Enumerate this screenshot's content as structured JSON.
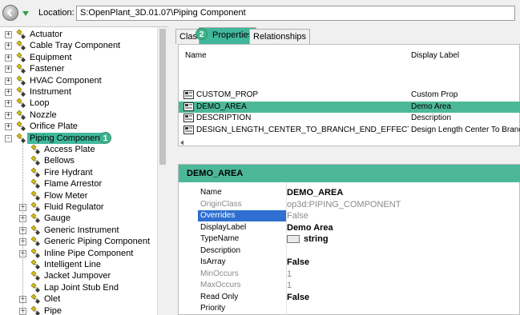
{
  "location": {
    "label": "Location:",
    "path": "S:OpenPlant_3D.01.07\\Piping Component"
  },
  "tree": {
    "top_items": [
      "Actuator",
      "Cable Tray Component",
      "Equipment",
      "Fastener",
      "HVAC Component",
      "Instrument",
      "Loop",
      "Nozzle",
      "Orifice Plate"
    ],
    "selected": "Piping Component",
    "selected_badge": "1",
    "children": [
      {
        "label": "Access Plate",
        "expandable": false
      },
      {
        "label": "Bellows",
        "expandable": false
      },
      {
        "label": "Fire Hydrant",
        "expandable": false
      },
      {
        "label": "Flame Arrestor",
        "expandable": false
      },
      {
        "label": "Flow Meter",
        "expandable": false
      },
      {
        "label": "Fluid Regulator",
        "expandable": true
      },
      {
        "label": "Gauge",
        "expandable": true
      },
      {
        "label": "Generic Instrument",
        "expandable": true
      },
      {
        "label": "Generic Piping Component",
        "expandable": true
      },
      {
        "label": "Inline Pipe Component",
        "expandable": true
      },
      {
        "label": "Intelligent Line",
        "expandable": false
      },
      {
        "label": "Jacket Jumpover",
        "expandable": false
      },
      {
        "label": "Lap Joint Stub End",
        "expandable": false
      },
      {
        "label": "Olet",
        "expandable": true
      },
      {
        "label": "Pipe",
        "expandable": true
      }
    ]
  },
  "tabs": {
    "class": "Class",
    "properties": "Properties",
    "relationships": "Relationships",
    "badge": "2"
  },
  "grid": {
    "col_name": "Name",
    "col_label": "Display Label",
    "rows": [
      {
        "name": "CUSTOM_PROP",
        "label": "Custom Prop"
      },
      {
        "name": "DEMO_AREA",
        "label": "Demo Area"
      },
      {
        "name": "DESCRIPTION",
        "label": "Description"
      },
      {
        "name": "DESIGN_LENGTH_CENTER_TO_BRANCH_END_EFFECTIVE",
        "label": "Design Length Center To Branch"
      }
    ]
  },
  "detail": {
    "title": "DEMO_AREA",
    "props": [
      {
        "name": "Name",
        "value": "DEMO_AREA",
        "style": "bold",
        "name_style": ""
      },
      {
        "name": "OriginClass",
        "value": "op3d:PIPING_COMPONENT",
        "style": "dim",
        "name_style": "dim"
      },
      {
        "name": "Overrides",
        "value": "False",
        "style": "dim",
        "name_style": "hl"
      },
      {
        "name": "DisplayLabel",
        "value": "Demo Area",
        "style": "bold",
        "name_style": ""
      },
      {
        "name": "TypeName",
        "value": "string",
        "style": "bold",
        "name_style": ""
      },
      {
        "name": "Description",
        "value": "",
        "style": "",
        "name_style": ""
      },
      {
        "name": "IsArray",
        "value": "False",
        "style": "bold",
        "name_style": ""
      },
      {
        "name": "MinOccurs",
        "value": "1",
        "style": "dim",
        "name_style": "dim"
      },
      {
        "name": "MaxOccurs",
        "value": "1",
        "style": "dim",
        "name_style": "dim"
      },
      {
        "name": "Read Only",
        "value": "False",
        "style": "bold",
        "name_style": ""
      },
      {
        "name": "Priority",
        "value": "",
        "style": "",
        "name_style": ""
      }
    ]
  },
  "colors": {
    "selection": "#41b79b",
    "badge": "#3fb58e",
    "highlight": "#2f6fd1"
  }
}
